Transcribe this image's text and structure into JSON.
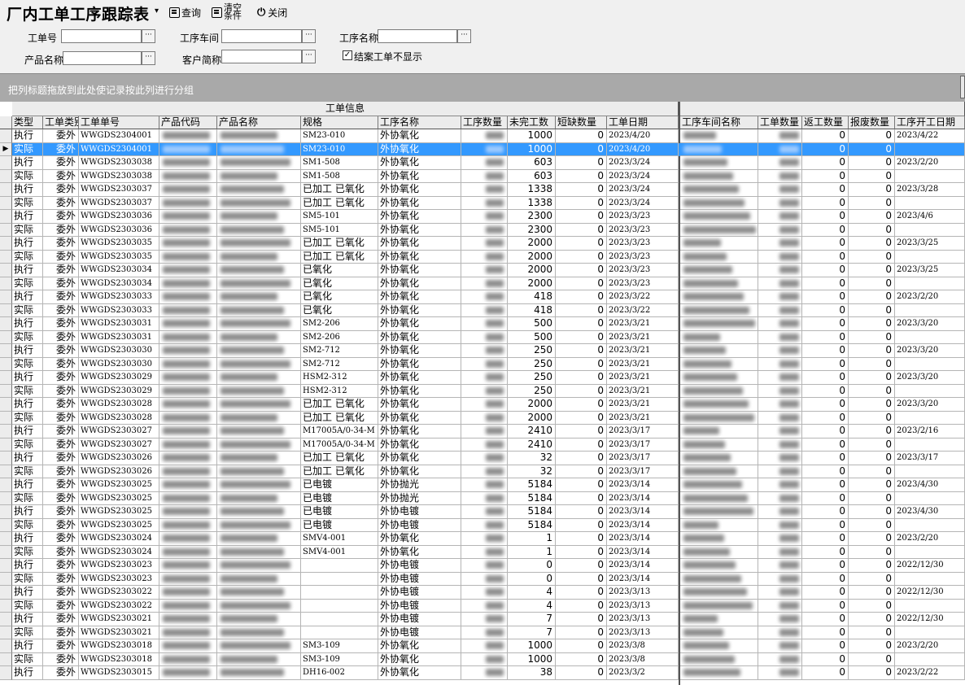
{
  "app": {
    "title": "厂内工单工序跟踪表",
    "query_label": "查询",
    "clear_label_1": "清空",
    "clear_label_2": "条件",
    "close_label": "关闭"
  },
  "filters": {
    "order_no_label": "工单号",
    "workshop_label": "工序车间",
    "process_name_label": "工序名称",
    "product_name_label": "产品名称",
    "customer_label": "客户简称",
    "hide_closed_label": "结案工单不显示",
    "order_no_value": "",
    "workshop_value": "",
    "process_name_value": "",
    "product_name_value": "",
    "customer_value": "",
    "hide_closed_checked": true,
    "ellipsis": "···"
  },
  "group_panel_hint": "把列标题拖放到此处使记录按此列进行分组",
  "grid": {
    "band_left": "工单信息",
    "band_right": "",
    "columns": {
      "type": "类型",
      "order_kind": "工单类别",
      "order_no": "工单单号",
      "product_code": "产品代码",
      "product_name": "产品名称",
      "spec": "规格",
      "process_name": "工序名称",
      "process_qty": "工序数量",
      "unfinished": "未完工数",
      "short_qty": "短缺数量",
      "order_date": "工单日期",
      "workshop_name": "工序车间名称",
      "order_qty": "工单数量",
      "rework_qty": "返工数量",
      "scrap_qty": "报废数量",
      "start_date": "工序开工日期"
    },
    "selected_row": 1,
    "rows": [
      {
        "type": "执行",
        "kind": "委外",
        "no": "WWGDS2304001",
        "spec": "SM23-010",
        "proc": "外协氧化",
        "unf": "1000",
        "short": "0",
        "date": "2023/4/20",
        "rework": "0",
        "scrap": "0",
        "start": "2023/4/22"
      },
      {
        "type": "实际",
        "kind": "委外",
        "no": "WWGDS2304001",
        "spec": "SM23-010",
        "proc": "外协氧化",
        "unf": "1000",
        "short": "0",
        "date": "2023/4/20",
        "rework": "0",
        "scrap": "0",
        "start": ""
      },
      {
        "type": "执行",
        "kind": "委外",
        "no": "WWGDS2303038",
        "spec": "SM1-508",
        "proc": "外协氧化",
        "unf": "603",
        "short": "0",
        "date": "2023/3/24",
        "rework": "0",
        "scrap": "0",
        "start": "2023/2/20"
      },
      {
        "type": "实际",
        "kind": "委外",
        "no": "WWGDS2303038",
        "spec": "SM1-508",
        "proc": "外协氧化",
        "unf": "603",
        "short": "0",
        "date": "2023/3/24",
        "rework": "0",
        "scrap": "0",
        "start": ""
      },
      {
        "type": "执行",
        "kind": "委外",
        "no": "WWGDS2303037",
        "spec": "已加工 已氧化",
        "proc": "外协氧化",
        "unf": "1338",
        "short": "0",
        "date": "2023/3/24",
        "rework": "0",
        "scrap": "0",
        "start": "2023/3/28"
      },
      {
        "type": "实际",
        "kind": "委外",
        "no": "WWGDS2303037",
        "spec": "已加工 已氧化",
        "proc": "外协氧化",
        "unf": "1338",
        "short": "0",
        "date": "2023/3/24",
        "rework": "0",
        "scrap": "0",
        "start": ""
      },
      {
        "type": "执行",
        "kind": "委外",
        "no": "WWGDS2303036",
        "spec": "SM5-101",
        "proc": "外协氧化",
        "unf": "2300",
        "short": "0",
        "date": "2023/3/23",
        "rework": "0",
        "scrap": "0",
        "start": "2023/4/6"
      },
      {
        "type": "实际",
        "kind": "委外",
        "no": "WWGDS2303036",
        "spec": "SM5-101",
        "proc": "外协氧化",
        "unf": "2300",
        "short": "0",
        "date": "2023/3/23",
        "rework": "0",
        "scrap": "0",
        "start": ""
      },
      {
        "type": "执行",
        "kind": "委外",
        "no": "WWGDS2303035",
        "spec": "已加工 已氧化",
        "proc": "外协氧化",
        "unf": "2000",
        "short": "0",
        "date": "2023/3/23",
        "rework": "0",
        "scrap": "0",
        "start": "2023/3/25"
      },
      {
        "type": "实际",
        "kind": "委外",
        "no": "WWGDS2303035",
        "spec": "已加工 已氧化",
        "proc": "外协氧化",
        "unf": "2000",
        "short": "0",
        "date": "2023/3/23",
        "rework": "0",
        "scrap": "0",
        "start": ""
      },
      {
        "type": "执行",
        "kind": "委外",
        "no": "WWGDS2303034",
        "spec": "已氧化",
        "proc": "外协氧化",
        "unf": "2000",
        "short": "0",
        "date": "2023/3/23",
        "rework": "0",
        "scrap": "0",
        "start": "2023/3/25"
      },
      {
        "type": "实际",
        "kind": "委外",
        "no": "WWGDS2303034",
        "spec": "已氧化",
        "proc": "外协氧化",
        "unf": "2000",
        "short": "0",
        "date": "2023/3/23",
        "rework": "0",
        "scrap": "0",
        "start": ""
      },
      {
        "type": "执行",
        "kind": "委外",
        "no": "WWGDS2303033",
        "spec": "已氧化",
        "proc": "外协氧化",
        "unf": "418",
        "short": "0",
        "date": "2023/3/22",
        "rework": "0",
        "scrap": "0",
        "start": "2023/2/20"
      },
      {
        "type": "实际",
        "kind": "委外",
        "no": "WWGDS2303033",
        "spec": "已氧化",
        "proc": "外协氧化",
        "unf": "418",
        "short": "0",
        "date": "2023/3/22",
        "rework": "0",
        "scrap": "0",
        "start": ""
      },
      {
        "type": "执行",
        "kind": "委外",
        "no": "WWGDS2303031",
        "spec": "SM2-206",
        "proc": "外协氧化",
        "unf": "500",
        "short": "0",
        "date": "2023/3/21",
        "rework": "0",
        "scrap": "0",
        "start": "2023/3/20"
      },
      {
        "type": "实际",
        "kind": "委外",
        "no": "WWGDS2303031",
        "spec": "SM2-206",
        "proc": "外协氧化",
        "unf": "500",
        "short": "0",
        "date": "2023/3/21",
        "rework": "0",
        "scrap": "0",
        "start": ""
      },
      {
        "type": "执行",
        "kind": "委外",
        "no": "WWGDS2303030",
        "spec": "SM2-712",
        "proc": "外协氧化",
        "unf": "250",
        "short": "0",
        "date": "2023/3/21",
        "rework": "0",
        "scrap": "0",
        "start": "2023/3/20"
      },
      {
        "type": "实际",
        "kind": "委外",
        "no": "WWGDS2303030",
        "spec": "SM2-712",
        "proc": "外协氧化",
        "unf": "250",
        "short": "0",
        "date": "2023/3/21",
        "rework": "0",
        "scrap": "0",
        "start": ""
      },
      {
        "type": "执行",
        "kind": "委外",
        "no": "WWGDS2303029",
        "spec": "HSM2-312",
        "proc": "外协氧化",
        "unf": "250",
        "short": "0",
        "date": "2023/3/21",
        "rework": "0",
        "scrap": "0",
        "start": "2023/3/20"
      },
      {
        "type": "实际",
        "kind": "委外",
        "no": "WWGDS2303029",
        "spec": "HSM2-312",
        "proc": "外协氧化",
        "unf": "250",
        "short": "0",
        "date": "2023/3/21",
        "rework": "0",
        "scrap": "0",
        "start": ""
      },
      {
        "type": "执行",
        "kind": "委外",
        "no": "WWGDS2303028",
        "spec": "已加工 已氧化",
        "proc": "外协氧化",
        "unf": "2000",
        "short": "0",
        "date": "2023/3/21",
        "rework": "0",
        "scrap": "0",
        "start": "2023/3/20"
      },
      {
        "type": "实际",
        "kind": "委外",
        "no": "WWGDS2303028",
        "spec": "已加工 已氧化",
        "proc": "外协氧化",
        "unf": "2000",
        "short": "0",
        "date": "2023/3/21",
        "rework": "0",
        "scrap": "0",
        "start": ""
      },
      {
        "type": "执行",
        "kind": "委外",
        "no": "WWGDS2303027",
        "spec": "M17005A/0-34-M",
        "proc": "外协氧化",
        "unf": "2410",
        "short": "0",
        "date": "2023/3/17",
        "rework": "0",
        "scrap": "0",
        "start": "2023/2/16"
      },
      {
        "type": "实际",
        "kind": "委外",
        "no": "WWGDS2303027",
        "spec": "M17005A/0-34-M",
        "proc": "外协氧化",
        "unf": "2410",
        "short": "0",
        "date": "2023/3/17",
        "rework": "0",
        "scrap": "0",
        "start": ""
      },
      {
        "type": "执行",
        "kind": "委外",
        "no": "WWGDS2303026",
        "spec": "已加工 已氧化",
        "proc": "外协氧化",
        "unf": "32",
        "short": "0",
        "date": "2023/3/17",
        "rework": "0",
        "scrap": "0",
        "start": "2023/3/17"
      },
      {
        "type": "实际",
        "kind": "委外",
        "no": "WWGDS2303026",
        "spec": "已加工 已氧化",
        "proc": "外协氧化",
        "unf": "32",
        "short": "0",
        "date": "2023/3/17",
        "rework": "0",
        "scrap": "0",
        "start": ""
      },
      {
        "type": "执行",
        "kind": "委外",
        "no": "WWGDS2303025",
        "spec": "已电镀",
        "proc": "外协抛光",
        "unf": "5184",
        "short": "0",
        "date": "2023/3/14",
        "rework": "0",
        "scrap": "0",
        "start": "2023/4/30"
      },
      {
        "type": "实际",
        "kind": "委外",
        "no": "WWGDS2303025",
        "spec": "已电镀",
        "proc": "外协抛光",
        "unf": "5184",
        "short": "0",
        "date": "2023/3/14",
        "rework": "0",
        "scrap": "0",
        "start": ""
      },
      {
        "type": "执行",
        "kind": "委外",
        "no": "WWGDS2303025",
        "spec": "已电镀",
        "proc": "外协电镀",
        "unf": "5184",
        "short": "0",
        "date": "2023/3/14",
        "rework": "0",
        "scrap": "0",
        "start": "2023/4/30"
      },
      {
        "type": "实际",
        "kind": "委外",
        "no": "WWGDS2303025",
        "spec": "已电镀",
        "proc": "外协电镀",
        "unf": "5184",
        "short": "0",
        "date": "2023/3/14",
        "rework": "0",
        "scrap": "0",
        "start": ""
      },
      {
        "type": "执行",
        "kind": "委外",
        "no": "WWGDS2303024",
        "spec": "SMV4-001",
        "proc": "外协氧化",
        "unf": "1",
        "short": "0",
        "date": "2023/3/14",
        "rework": "0",
        "scrap": "0",
        "start": "2023/2/20"
      },
      {
        "type": "实际",
        "kind": "委外",
        "no": "WWGDS2303024",
        "spec": "SMV4-001",
        "proc": "外协氧化",
        "unf": "1",
        "short": "0",
        "date": "2023/3/14",
        "rework": "0",
        "scrap": "0",
        "start": ""
      },
      {
        "type": "执行",
        "kind": "委外",
        "no": "WWGDS2303023",
        "spec": "",
        "proc": "外协电镀",
        "unf": "0",
        "short": "0",
        "date": "2023/3/14",
        "rework": "0",
        "scrap": "0",
        "start": "2022/12/30"
      },
      {
        "type": "实际",
        "kind": "委外",
        "no": "WWGDS2303023",
        "spec": "",
        "proc": "外协电镀",
        "unf": "0",
        "short": "0",
        "date": "2023/3/14",
        "rework": "0",
        "scrap": "0",
        "start": ""
      },
      {
        "type": "执行",
        "kind": "委外",
        "no": "WWGDS2303022",
        "spec": "",
        "proc": "外协电镀",
        "unf": "4",
        "short": "0",
        "date": "2023/3/13",
        "rework": "0",
        "scrap": "0",
        "start": "2022/12/30"
      },
      {
        "type": "实际",
        "kind": "委外",
        "no": "WWGDS2303022",
        "spec": "",
        "proc": "外协电镀",
        "unf": "4",
        "short": "0",
        "date": "2023/3/13",
        "rework": "0",
        "scrap": "0",
        "start": ""
      },
      {
        "type": "执行",
        "kind": "委外",
        "no": "WWGDS2303021",
        "spec": "",
        "proc": "外协电镀",
        "unf": "7",
        "short": "0",
        "date": "2023/3/13",
        "rework": "0",
        "scrap": "0",
        "start": "2022/12/30"
      },
      {
        "type": "实际",
        "kind": "委外",
        "no": "WWGDS2303021",
        "spec": "",
        "proc": "外协电镀",
        "unf": "7",
        "short": "0",
        "date": "2023/3/13",
        "rework": "0",
        "scrap": "0",
        "start": ""
      },
      {
        "type": "执行",
        "kind": "委外",
        "no": "WWGDS2303018",
        "spec": "SM3-109",
        "proc": "外协氧化",
        "unf": "1000",
        "short": "0",
        "date": "2023/3/8",
        "rework": "0",
        "scrap": "0",
        "start": "2023/2/20"
      },
      {
        "type": "实际",
        "kind": "委外",
        "no": "WWGDS2303018",
        "spec": "SM3-109",
        "proc": "外协氧化",
        "unf": "1000",
        "short": "0",
        "date": "2023/3/8",
        "rework": "0",
        "scrap": "0",
        "start": ""
      },
      {
        "type": "执行",
        "kind": "委外",
        "no": "WWGDS2303015",
        "spec": "DH16-002",
        "proc": "外协氧化",
        "unf": "38",
        "short": "0",
        "date": "2023/3/2",
        "rework": "0",
        "scrap": "0",
        "start": "2023/2/22"
      }
    ]
  },
  "colors": {
    "selection": "#3399ff",
    "group_panel": "#a9a9a9",
    "chrome": "#f0f0f0"
  }
}
